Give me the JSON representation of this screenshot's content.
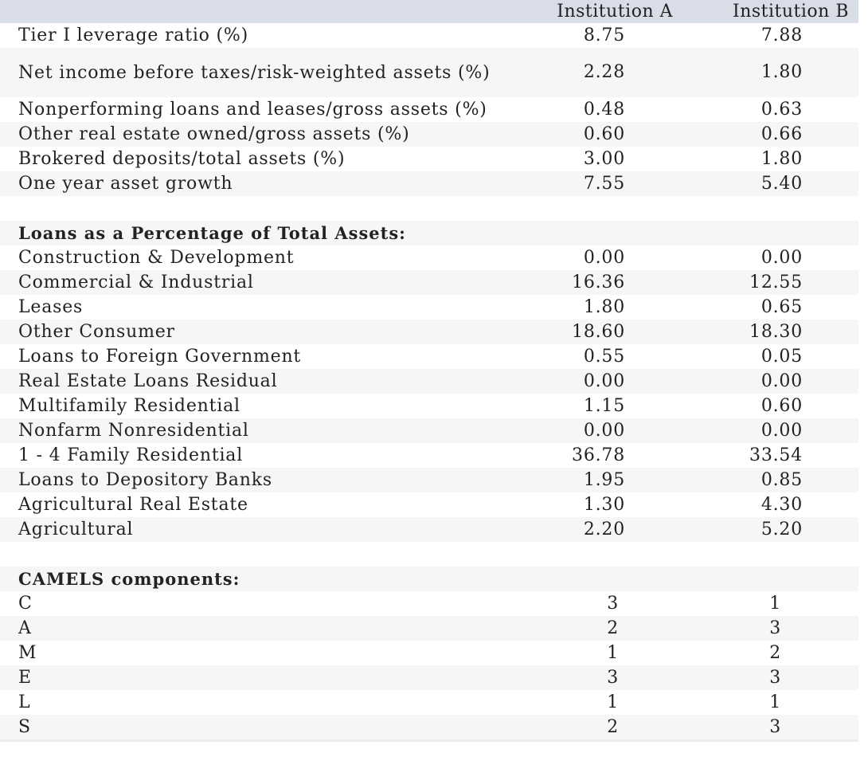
{
  "columns": {
    "label": "",
    "institution_a": "Institution A",
    "institution_b": "Institution B"
  },
  "ratios": [
    {
      "label": "Tier I leverage ratio (%)",
      "a": "8.75",
      "b": "7.88"
    },
    {
      "label": "Net income before taxes/risk-weighted assets (%)",
      "a": "2.28",
      "b": "1.80"
    },
    {
      "label": "Nonperforming loans and leases/gross assets (%)",
      "a": "0.48",
      "b": "0.63"
    },
    {
      "label": "Other real estate owned/gross assets (%)",
      "a": "0.60",
      "b": "0.66"
    },
    {
      "label": "Brokered deposits/total assets (%)",
      "a": "3.00",
      "b": "1.80"
    },
    {
      "label": "One year asset growth",
      "a": "7.55",
      "b": "5.40"
    }
  ],
  "loans_section": {
    "title": "Loans as a Percentage of Total Assets:",
    "rows": [
      {
        "label": "Construction & Development",
        "a": "0.00",
        "b": "0.00"
      },
      {
        "label": "Commercial & Industrial",
        "a": "16.36",
        "b": "12.55"
      },
      {
        "label": "Leases",
        "a": "1.80",
        "b": "0.65"
      },
      {
        "label": "Other Consumer",
        "a": "18.60",
        "b": "18.30"
      },
      {
        "label": "Loans to Foreign Government",
        "a": "0.55",
        "b": "0.05"
      },
      {
        "label": "Real Estate Loans Residual",
        "a": "0.00",
        "b": "0.00"
      },
      {
        "label": "Multifamily Residential",
        "a": "1.15",
        "b": "0.60"
      },
      {
        "label": "Nonfarm Nonresidential",
        "a": "0.00",
        "b": "0.00"
      },
      {
        "label": "1 - 4 Family Residential",
        "a": "36.78",
        "b": "33.54"
      },
      {
        "label": "Loans to Depository Banks",
        "a": "1.95",
        "b": "0.85"
      },
      {
        "label": "Agricultural Real Estate",
        "a": "1.30",
        "b": "4.30"
      },
      {
        "label": "Agricultural",
        "a": "2.20",
        "b": "5.20"
      }
    ]
  },
  "camels_section": {
    "title": "CAMELS components:",
    "rows": [
      {
        "label": "C",
        "a": "3",
        "b": "1"
      },
      {
        "label": "A",
        "a": "2",
        "b": "3"
      },
      {
        "label": "M",
        "a": "1",
        "b": "2"
      },
      {
        "label": "E",
        "a": "3",
        "b": "3"
      },
      {
        "label": "L",
        "a": "1",
        "b": "1"
      },
      {
        "label": "S",
        "a": "2",
        "b": "3"
      }
    ]
  }
}
